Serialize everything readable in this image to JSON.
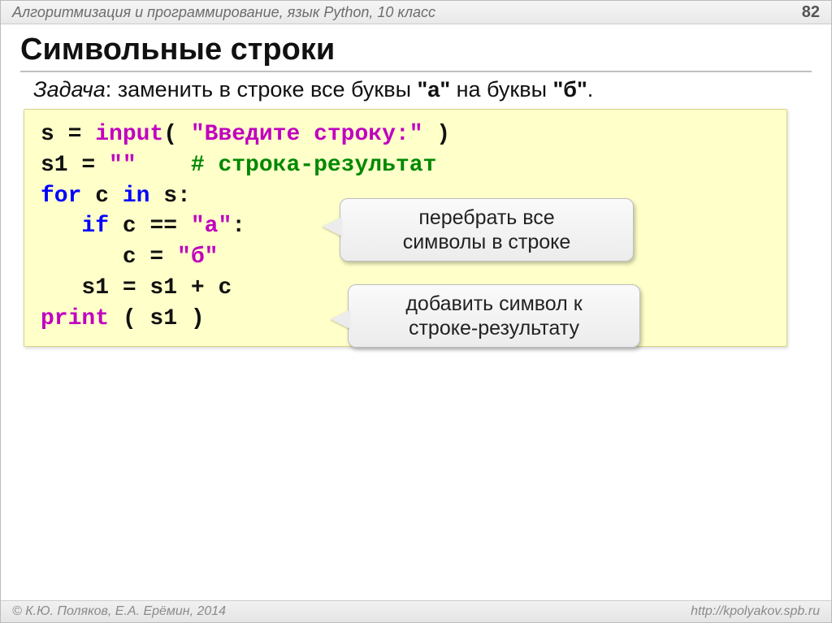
{
  "header": {
    "course": "Алгоритмизация и программирование, язык Python, 10 класс",
    "page_number": "82"
  },
  "title": "Символьные строки",
  "task": {
    "label": "Задача",
    "text_before": ": заменить в строке все буквы ",
    "quote_a": "\"а\"",
    "text_middle": " на буквы ",
    "quote_b": "\"б\"",
    "tail": "."
  },
  "code": {
    "l1a": "s = ",
    "l1_input": "input",
    "l1_paren_open": "( ",
    "l1_str": "\"Введите строку:\"",
    "l1_paren_close": " )",
    "l2a": "s1 = ",
    "l2_str": "\"\"",
    "l2_gap": "    ",
    "l2_cmt": "# строка-результат",
    "l3_for": "for",
    "l3_mid": " c ",
    "l3_in": "in",
    "l3_tail": " s:",
    "l4_indent": "   ",
    "l4_if": "if",
    "l4_mid": " c == ",
    "l4_str": "\"а\"",
    "l4_tail": ":",
    "l5_indent": "      ",
    "l5a": "c = ",
    "l5_str": "\"б\"",
    "l6_indent": "   ",
    "l6": "s1 = s1 + c",
    "l7_print": "print",
    "l7_tail": " ( s1 )"
  },
  "callouts": {
    "c1_line1": "перебрать все",
    "c1_line2": "символы в строке",
    "c2_line1": "добавить символ к",
    "c2_line2": "строке-результату"
  },
  "footer": {
    "left": "© К.Ю. Поляков, Е.А. Ерёмин, 2014",
    "right": "http://kpolyakov.spb.ru"
  }
}
